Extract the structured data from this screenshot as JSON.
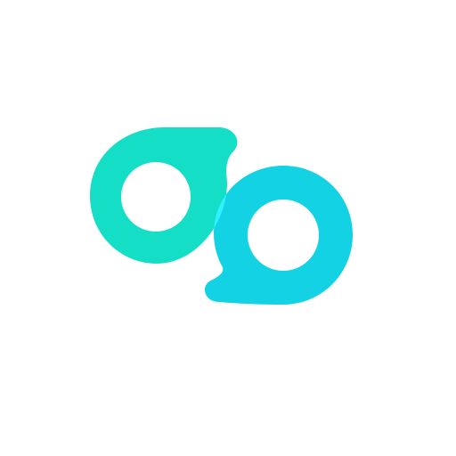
{
  "logo": {
    "icon": "two-linked-chat-bubbles-icon",
    "colors": {
      "left_bubble": "#14DEC6",
      "right_bubble": "#12D2E4",
      "overlap": "#30F2FF",
      "background": "#FFFFFF"
    }
  }
}
